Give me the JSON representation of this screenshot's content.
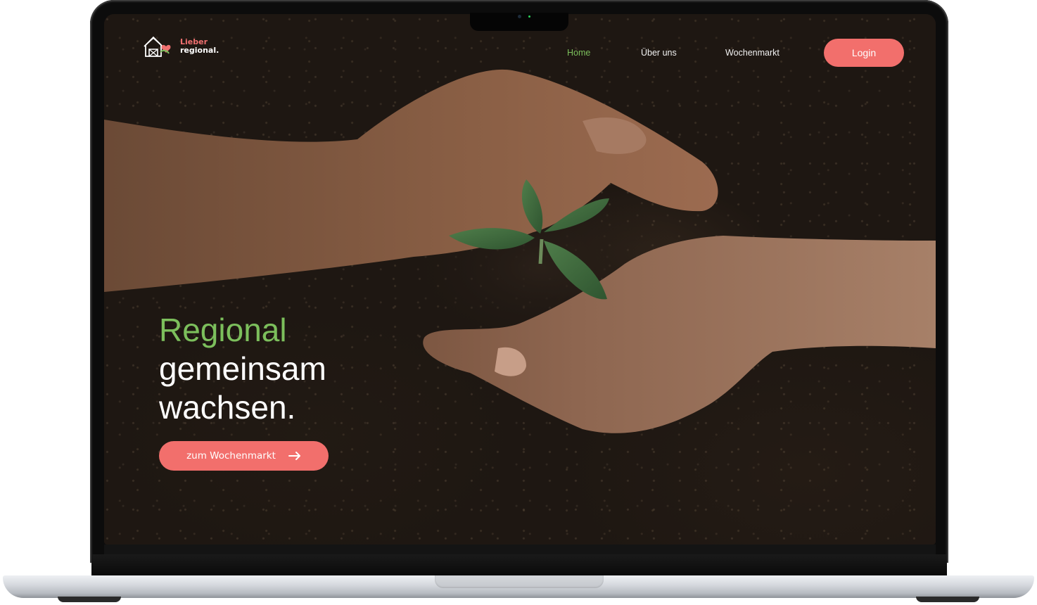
{
  "brand": {
    "line1": "Lieber",
    "line2": "regional.",
    "logo_icon": "farm-barn-heart-icon",
    "accent_color": "#f26f6c",
    "green_color": "#7cbf5c"
  },
  "nav": {
    "items": [
      {
        "label": "Home",
        "active": true
      },
      {
        "label": "Über uns",
        "active": false
      },
      {
        "label": "Wochenmarkt",
        "active": false
      }
    ],
    "login_label": "Login"
  },
  "hero": {
    "headline_accent": "Regional",
    "headline_line2": "gemeinsam",
    "headline_line3": "wachsen.",
    "cta_label": "zum Wochenmarkt",
    "cta_icon": "arrow-right-icon",
    "background": "hands-protecting-seedling-photo"
  }
}
